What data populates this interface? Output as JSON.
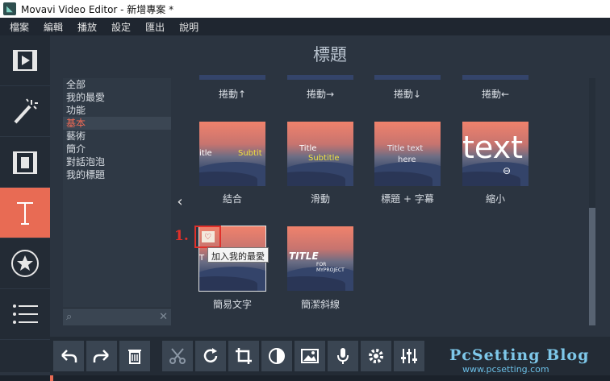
{
  "window": {
    "title": "Movavi Video Editor - 新增專案 *",
    "icon": "movavi-app-icon"
  },
  "menu": [
    "檔案",
    "編輯",
    "播放",
    "設定",
    "匯出",
    "說明"
  ],
  "left_tools": [
    {
      "name": "import-media-icon"
    },
    {
      "name": "filters-wand-icon"
    },
    {
      "name": "transitions-icon"
    },
    {
      "name": "titles-icon",
      "active": true
    },
    {
      "name": "stickers-star-icon"
    },
    {
      "name": "more-menu-icon"
    }
  ],
  "panel": {
    "title": "標題"
  },
  "categories": [
    "全部",
    "我的最愛",
    "功能",
    "基本",
    "藝術",
    "簡介",
    "對話泡泡",
    "我的標題"
  ],
  "selected_category": "基本",
  "top_row_labels": [
    "捲動↑",
    "捲動→",
    "捲動↓",
    "捲動←"
  ],
  "middle_row": [
    {
      "label": "結合",
      "text1": "itle",
      "text2": "Subtit"
    },
    {
      "label": "滑動",
      "text1": "Title",
      "text2": "Subtitle"
    },
    {
      "label": "標題 + 字幕",
      "text1": "Title text",
      "text2": "here"
    },
    {
      "label": "縮小",
      "text1": "text"
    }
  ],
  "bottom_row": [
    {
      "label": "簡易文字",
      "text1": "T"
    },
    {
      "label": "簡潔斜線",
      "text1": "TITLE",
      "text2": "FOR MYPROJECT"
    }
  ],
  "annotation": {
    "step": "1.",
    "tooltip": "加入我的最愛"
  },
  "toolbar": [
    "undo-icon",
    "redo-icon",
    "delete-icon",
    "cut-icon",
    "rotate-icon",
    "crop-icon",
    "color-adjust-icon",
    "image-icon",
    "microphone-icon",
    "settings-gear-icon",
    "equalizer-icon"
  ],
  "watermark": {
    "line1": "PcSetting Blog",
    "line2": "www.pcsetting.com"
  }
}
